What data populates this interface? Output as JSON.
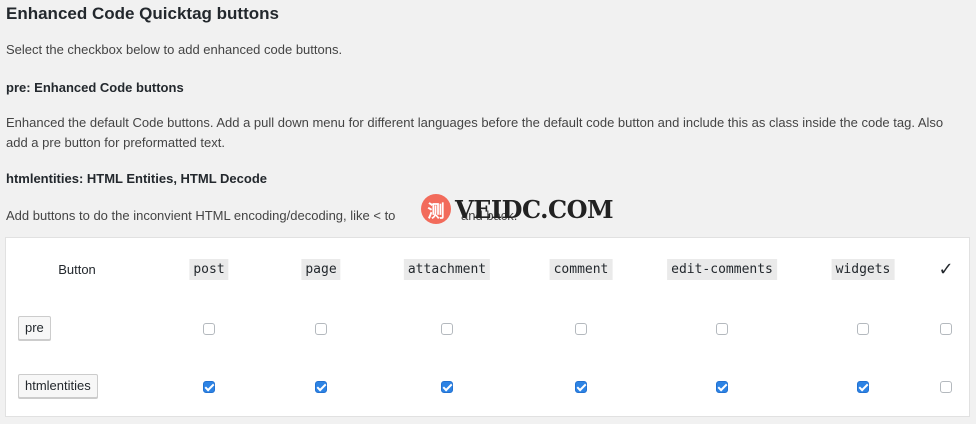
{
  "title": "Enhanced Code Quicktag buttons",
  "intro": "Select the checkbox below to add enhanced code buttons.",
  "pre_heading": "pre: Enhanced Code buttons",
  "pre_desc": "Enhanced the default Code buttons. Add a pull down menu for different languages before the default code button and include this as class inside the code tag. Also add a pre button for preformatted text.",
  "html_heading": "htmlentities: HTML Entities, HTML Decode",
  "html_desc": "Add buttons to do the inconvient HTML encoding/decoding, like < to",
  "html_desc_tail": "and back.",
  "watermark": {
    "logo_char": "测",
    "text": "VEIDC.COM"
  },
  "table": {
    "header_button": "Button",
    "columns": [
      "post",
      "page",
      "attachment",
      "comment",
      "edit-comments",
      "widgets"
    ],
    "all_icon": "checkmark-icon",
    "rows": [
      {
        "label": "pre",
        "checks": [
          false,
          false,
          false,
          false,
          false,
          false
        ],
        "all": false
      },
      {
        "label": "htmlentities",
        "checks": [
          true,
          true,
          true,
          true,
          true,
          true
        ],
        "all": false
      }
    ]
  },
  "colors": {
    "checked": "#2d83e4",
    "background": "#f1f1f1",
    "panel": "#ffffff"
  }
}
